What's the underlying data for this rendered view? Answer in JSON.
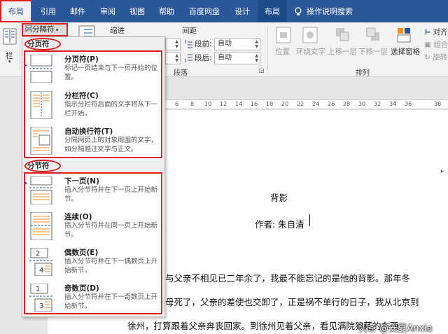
{
  "tabs": [
    {
      "label": "布局",
      "active": true
    },
    {
      "label": "引用"
    },
    {
      "label": "邮件"
    },
    {
      "label": "审阅"
    },
    {
      "label": "视图"
    },
    {
      "label": "帮助"
    },
    {
      "label": "百度网盘"
    },
    {
      "label": "设计"
    },
    {
      "label": "布局"
    },
    {
      "label": "操作说明搜索"
    }
  ],
  "ribbon": {
    "breaks_label": "分隔符",
    "indent_label": "缩进",
    "spacing_label": "间距",
    "before_label": "段前:",
    "after_label": "段后:",
    "before_value": "自动",
    "after_value": "自动",
    "paragraph_group": "段落",
    "arrange_group": "排列",
    "left_partial": "栏",
    "position": "位置",
    "wrap_text": "环绕文字",
    "bring_forward": "上移一层",
    "send_backward": "下移一层",
    "selection_pane": "选择窗格",
    "align": "对齐",
    "group_partial": "组合",
    "rotate_partial": "旋转"
  },
  "dropdown": {
    "page_breaks_header": "分页符",
    "section_breaks_header": "分节符",
    "items": [
      {
        "title": "分页符(P)",
        "desc": "标记一页结束与下一页开始的位置。",
        "icon": "page-break-icon"
      },
      {
        "title": "分栏符(C)",
        "desc": "指示分栏符后面的文字将从下一栏开始。",
        "icon": "column-break-icon"
      },
      {
        "title": "自动换行符(T)",
        "desc": "分隔网页上的对象周围的文字，如分隔题注文字与正文。",
        "icon": "text-wrapping-break-icon"
      },
      {
        "title": "下一页(N)",
        "desc": "插入分节符并在下一页上开始新节。",
        "icon": "next-page-section-icon"
      },
      {
        "title": "连续(O)",
        "desc": "插入分节符并在同一页上开始新节。",
        "icon": "continuous-section-icon"
      },
      {
        "title": "偶数页(E)",
        "desc": "插入分节符并在下一偶数页上开始新节。",
        "icon": "even-page-section-icon"
      },
      {
        "title": "奇数页(D)",
        "desc": "插入分节符并在下一奇数页上开始新节。",
        "icon": "odd-page-section-icon"
      }
    ]
  },
  "ruler": {
    "ticks": [
      "6",
      "8",
      "10",
      "12",
      "14",
      "16",
      "18",
      "20",
      "22",
      "24",
      "26",
      "28",
      "30",
      "32",
      "34",
      "36",
      "38"
    ]
  },
  "document": {
    "title": "背影",
    "author": "作者: 朱自清",
    "line1": "与父亲不相见已二年余了，我最不能忘记的是他的背影。那年冬",
    "line2": "母死了，父亲的差使也交卸了，正是祸不单行的日子，我从北京到",
    "line3": "徐州，打算跟着父亲奔丧回家。到徐州见着父亲，看见满院狼藉的东西，"
  },
  "watermark": "头条 @安夏Anxia",
  "colors": {
    "accent": "#2b579a",
    "highlight": "#e02020",
    "section_icon": "#f08c28"
  }
}
